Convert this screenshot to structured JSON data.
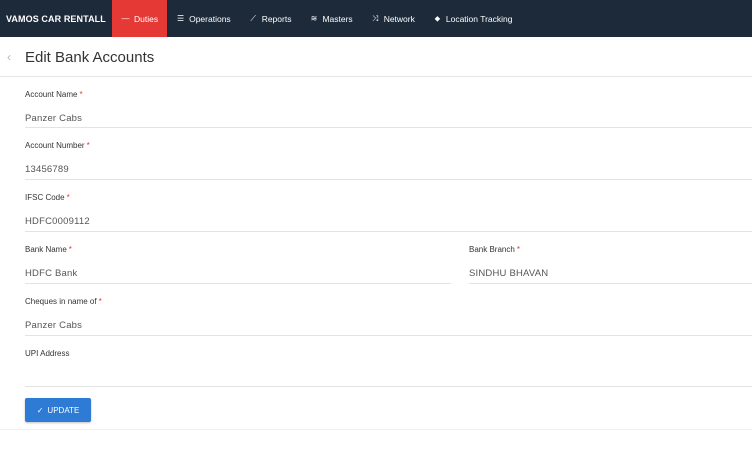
{
  "brand": "VAMOS CAR RENTALL",
  "nav": [
    {
      "label": "Duties",
      "icon": "minus-icon",
      "glyph": "—",
      "active": true
    },
    {
      "label": "Operations",
      "icon": "list-icon",
      "glyph": "☰",
      "active": false
    },
    {
      "label": "Reports",
      "icon": "line-chart-icon",
      "glyph": "⟋",
      "active": false
    },
    {
      "label": "Masters",
      "icon": "stack-icon",
      "glyph": "≋",
      "active": false
    },
    {
      "label": "Network",
      "icon": "shuffle-icon",
      "glyph": "⤨",
      "active": false
    },
    {
      "label": "Location Tracking",
      "icon": "map-pin-icon",
      "glyph": "⬥",
      "active": false
    }
  ],
  "page": {
    "title": "Edit Bank Accounts",
    "back_glyph": "‹"
  },
  "form": {
    "account_name": {
      "label": "Account Name",
      "required": "*",
      "value": "Panzer Cabs"
    },
    "account_number": {
      "label": "Account Number",
      "required": "*",
      "value": "13456789"
    },
    "ifsc_code": {
      "label": "IFSC Code",
      "required": "*",
      "value": "HDFC0009112"
    },
    "bank_name": {
      "label": "Bank Name",
      "required": "*",
      "value": "HDFC Bank"
    },
    "bank_branch": {
      "label": "Bank Branch",
      "required": "*",
      "value": "SINDHU BHAVAN"
    },
    "cheques_name": {
      "label": "Cheques in name of",
      "required": "*",
      "value": "Panzer Cabs"
    },
    "upi_address": {
      "label": "UPI Address",
      "required": "",
      "value": ""
    }
  },
  "actions": {
    "update_label": "UPDATE",
    "update_glyph": "✓"
  },
  "colors": {
    "nav_bg": "#1d2a3a",
    "active": "#e53935",
    "button": "#2e7bd6"
  }
}
